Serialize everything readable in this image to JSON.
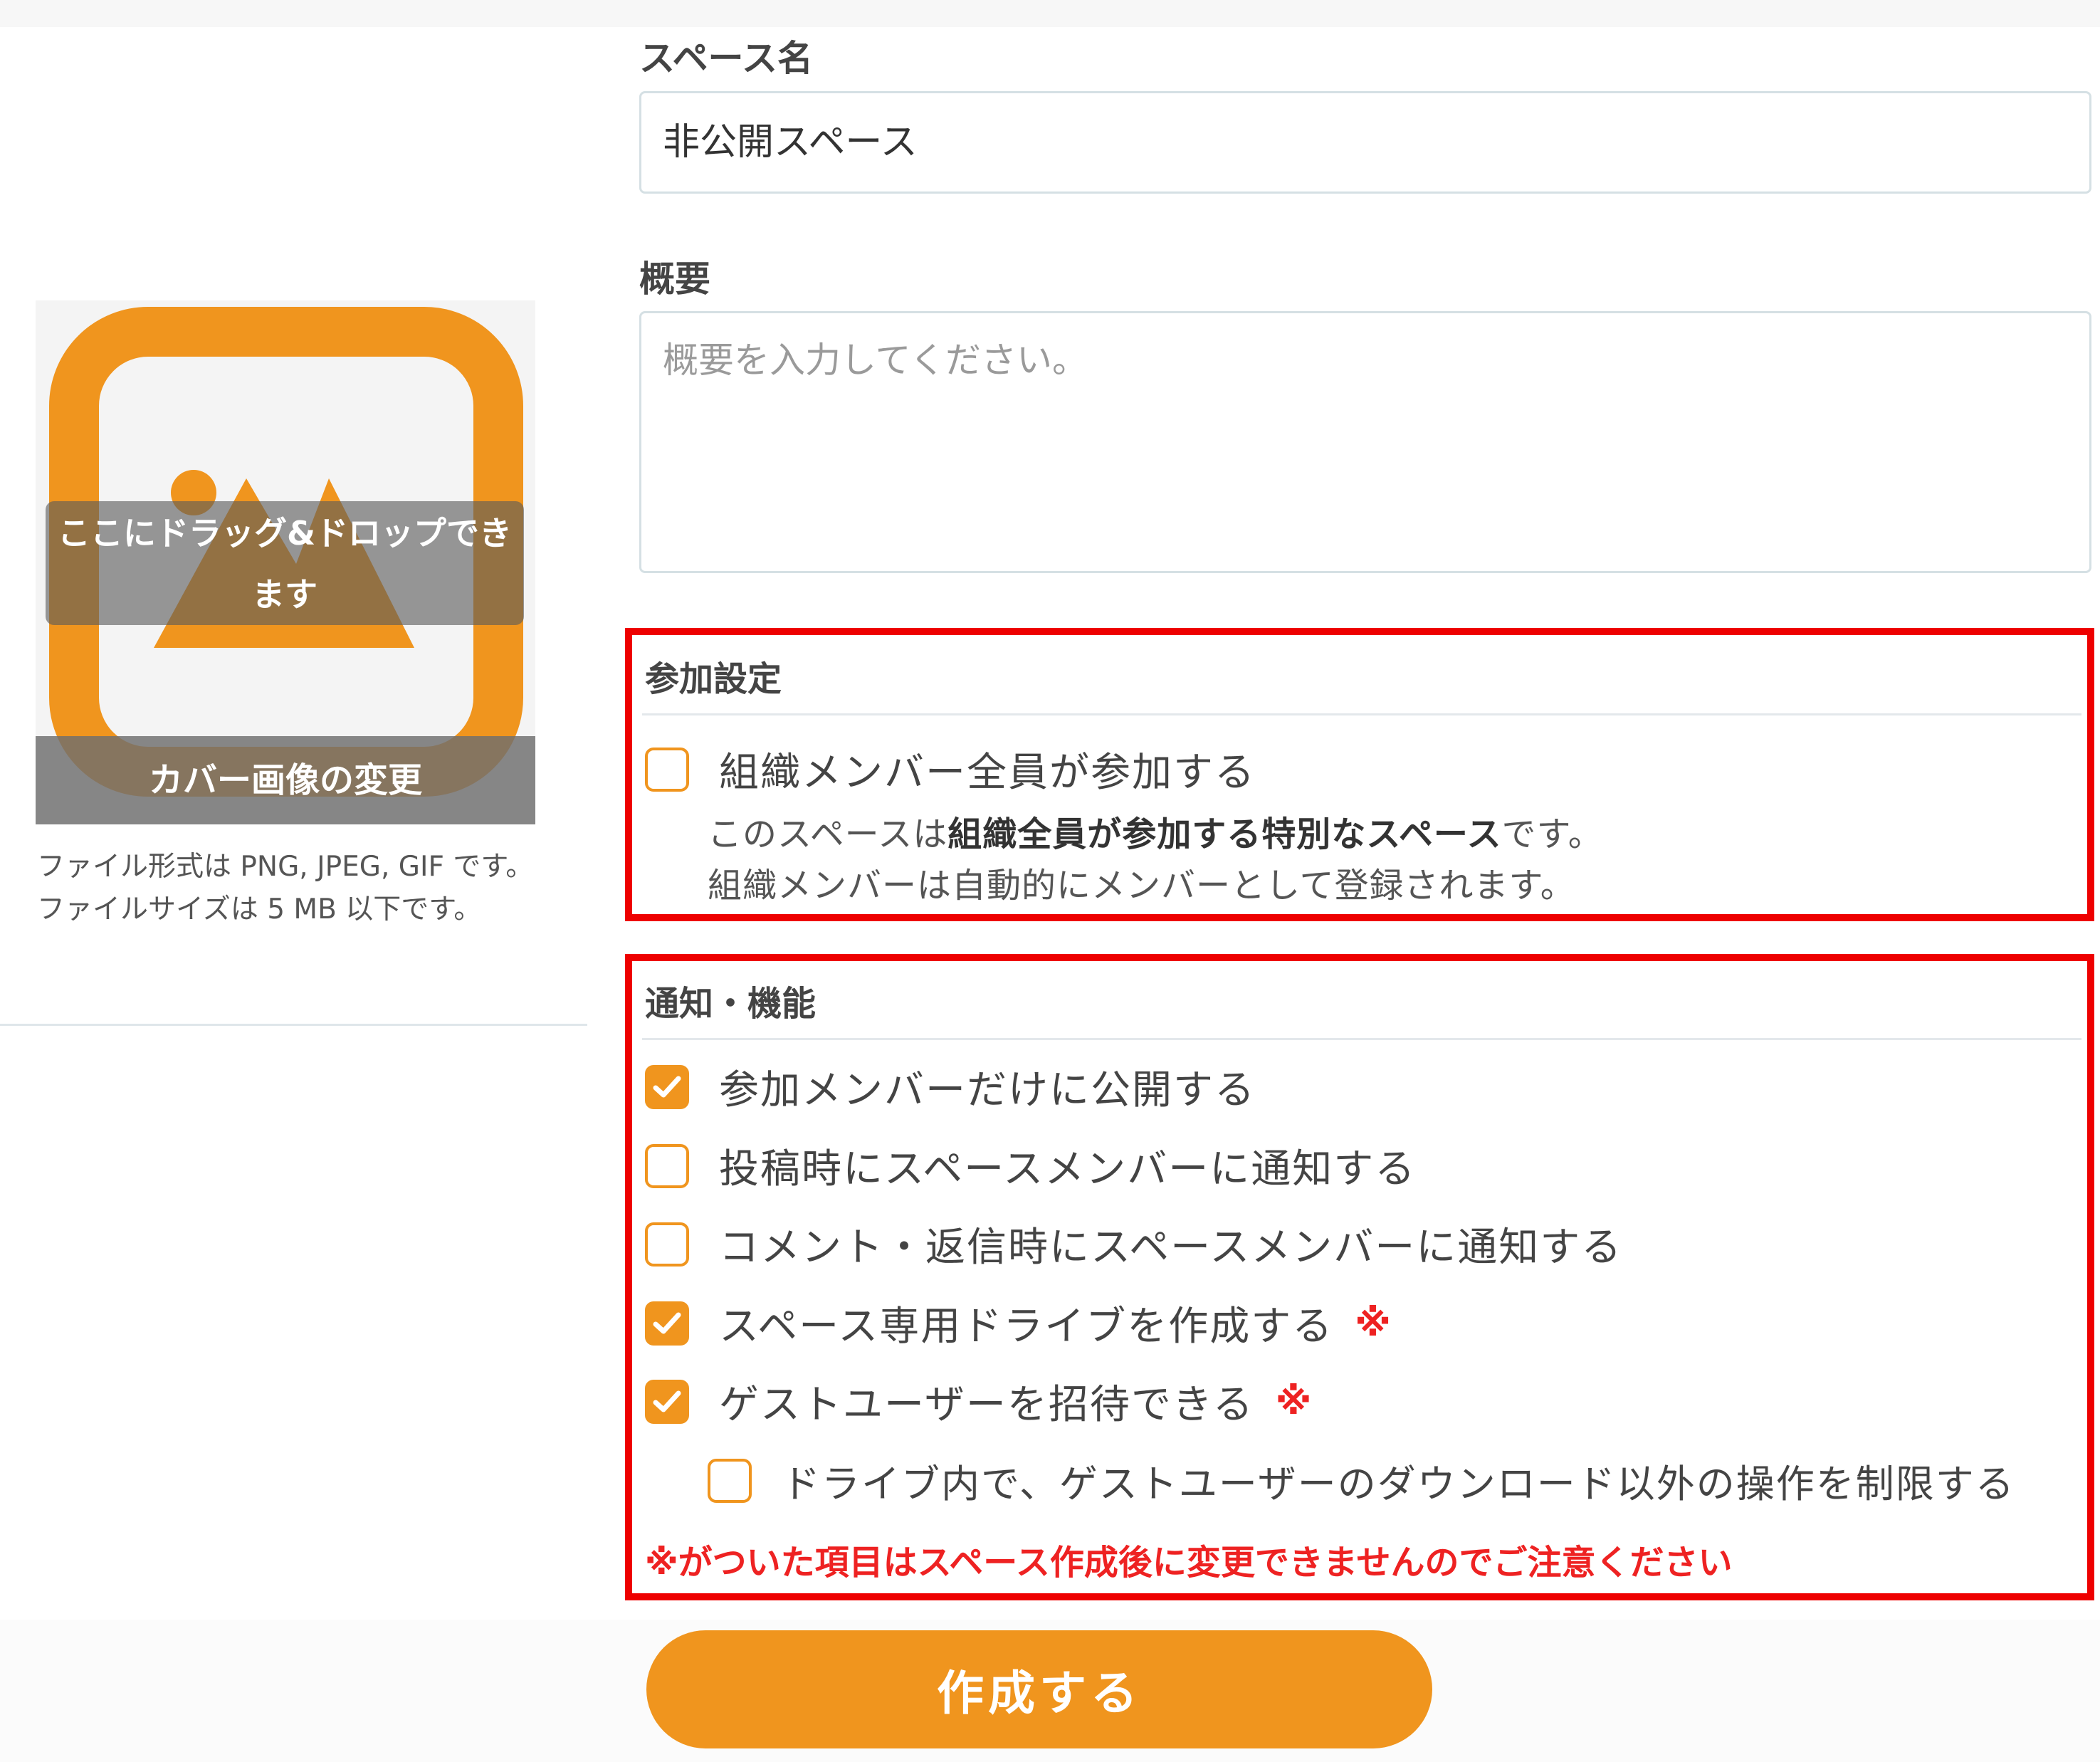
{
  "cover": {
    "drop_hint": "ここにドラッグ&ドロップできます",
    "change_label": "カバー画像の変更",
    "image_icon": "image-placeholder-icon",
    "file_format_note": "ファイル形式は PNG, JPEG, GIF です。",
    "file_size_note": "ファイルサイズは 5 MB 以下です。"
  },
  "form": {
    "space_name": {
      "label": "スペース名",
      "value": "非公開スペース"
    },
    "summary": {
      "label": "概要",
      "placeholder": "概要を入力してください。"
    }
  },
  "participation": {
    "title": "参加設定",
    "option": {
      "label": "組織メンバー全員が参加する",
      "checked": false
    },
    "desc_prefix": "このスペースは",
    "desc_bold": "組織全員が参加する特別なスペース",
    "desc_suffix": "です。",
    "desc_line2": "組織メンバーは自動的にメンバーとして登録されます。"
  },
  "features": {
    "title": "通知・機能",
    "required_mark": "※",
    "options": [
      {
        "label": "参加メンバーだけに公開する",
        "checked": true
      },
      {
        "label": "投稿時にスペースメンバーに通知する",
        "checked": false
      },
      {
        "label": "コメント・返信時にスペースメンバーに通知する",
        "checked": false
      },
      {
        "label": "スペース専用ドライブを作成する",
        "checked": true
      },
      {
        "label": "ゲストユーザーを招待できる",
        "checked": true
      },
      {
        "label": "ドライブ内で、ゲストユーザーのダウンロード以外の操作を制限する",
        "checked": false
      }
    ],
    "warning": "※がついた項目はスペース作成後に変更できませんのでご注意ください"
  },
  "submit": {
    "label": "作成する"
  },
  "colors": {
    "accent": "#f0951e",
    "highlight_border": "#ee0000",
    "warning_text": "#ee2222"
  }
}
